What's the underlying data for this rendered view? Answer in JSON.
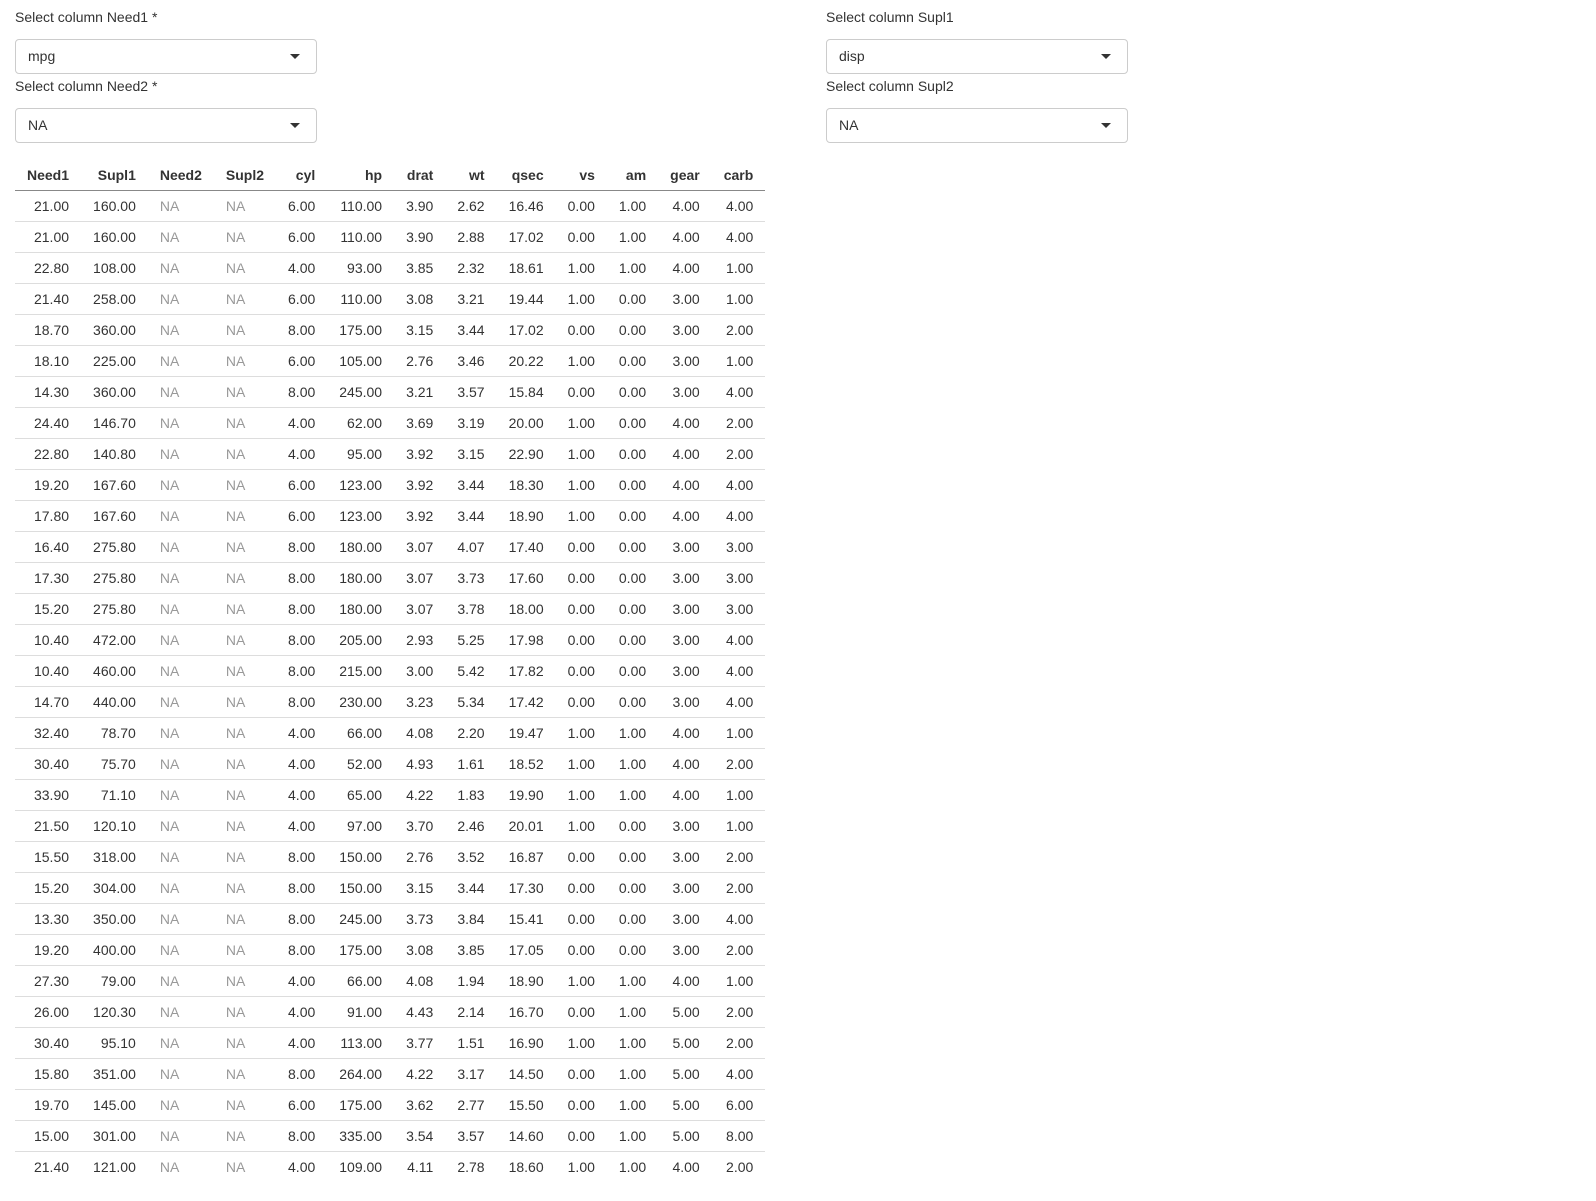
{
  "selectors": {
    "need1": {
      "label": "Select column Need1 *",
      "value": "mpg"
    },
    "need2": {
      "label": "Select column Need2 *",
      "value": "NA"
    },
    "supl1": {
      "label": "Select column Supl1",
      "value": "disp"
    },
    "supl2": {
      "label": "Select column Supl2",
      "value": "NA"
    }
  },
  "table": {
    "columns": [
      "Need1",
      "Supl1",
      "Need2",
      "Supl2",
      "cyl",
      "hp",
      "drat",
      "wt",
      "qsec",
      "vs",
      "am",
      "gear",
      "carb"
    ],
    "rows": [
      [
        "21.00",
        "160.00",
        "NA",
        "NA",
        "6.00",
        "110.00",
        "3.90",
        "2.62",
        "16.46",
        "0.00",
        "1.00",
        "4.00",
        "4.00"
      ],
      [
        "21.00",
        "160.00",
        "NA",
        "NA",
        "6.00",
        "110.00",
        "3.90",
        "2.88",
        "17.02",
        "0.00",
        "1.00",
        "4.00",
        "4.00"
      ],
      [
        "22.80",
        "108.00",
        "NA",
        "NA",
        "4.00",
        "93.00",
        "3.85",
        "2.32",
        "18.61",
        "1.00",
        "1.00",
        "4.00",
        "1.00"
      ],
      [
        "21.40",
        "258.00",
        "NA",
        "NA",
        "6.00",
        "110.00",
        "3.08",
        "3.21",
        "19.44",
        "1.00",
        "0.00",
        "3.00",
        "1.00"
      ],
      [
        "18.70",
        "360.00",
        "NA",
        "NA",
        "8.00",
        "175.00",
        "3.15",
        "3.44",
        "17.02",
        "0.00",
        "0.00",
        "3.00",
        "2.00"
      ],
      [
        "18.10",
        "225.00",
        "NA",
        "NA",
        "6.00",
        "105.00",
        "2.76",
        "3.46",
        "20.22",
        "1.00",
        "0.00",
        "3.00",
        "1.00"
      ],
      [
        "14.30",
        "360.00",
        "NA",
        "NA",
        "8.00",
        "245.00",
        "3.21",
        "3.57",
        "15.84",
        "0.00",
        "0.00",
        "3.00",
        "4.00"
      ],
      [
        "24.40",
        "146.70",
        "NA",
        "NA",
        "4.00",
        "62.00",
        "3.69",
        "3.19",
        "20.00",
        "1.00",
        "0.00",
        "4.00",
        "2.00"
      ],
      [
        "22.80",
        "140.80",
        "NA",
        "NA",
        "4.00",
        "95.00",
        "3.92",
        "3.15",
        "22.90",
        "1.00",
        "0.00",
        "4.00",
        "2.00"
      ],
      [
        "19.20",
        "167.60",
        "NA",
        "NA",
        "6.00",
        "123.00",
        "3.92",
        "3.44",
        "18.30",
        "1.00",
        "0.00",
        "4.00",
        "4.00"
      ],
      [
        "17.80",
        "167.60",
        "NA",
        "NA",
        "6.00",
        "123.00",
        "3.92",
        "3.44",
        "18.90",
        "1.00",
        "0.00",
        "4.00",
        "4.00"
      ],
      [
        "16.40",
        "275.80",
        "NA",
        "NA",
        "8.00",
        "180.00",
        "3.07",
        "4.07",
        "17.40",
        "0.00",
        "0.00",
        "3.00",
        "3.00"
      ],
      [
        "17.30",
        "275.80",
        "NA",
        "NA",
        "8.00",
        "180.00",
        "3.07",
        "3.73",
        "17.60",
        "0.00",
        "0.00",
        "3.00",
        "3.00"
      ],
      [
        "15.20",
        "275.80",
        "NA",
        "NA",
        "8.00",
        "180.00",
        "3.07",
        "3.78",
        "18.00",
        "0.00",
        "0.00",
        "3.00",
        "3.00"
      ],
      [
        "10.40",
        "472.00",
        "NA",
        "NA",
        "8.00",
        "205.00",
        "2.93",
        "5.25",
        "17.98",
        "0.00",
        "0.00",
        "3.00",
        "4.00"
      ],
      [
        "10.40",
        "460.00",
        "NA",
        "NA",
        "8.00",
        "215.00",
        "3.00",
        "5.42",
        "17.82",
        "0.00",
        "0.00",
        "3.00",
        "4.00"
      ],
      [
        "14.70",
        "440.00",
        "NA",
        "NA",
        "8.00",
        "230.00",
        "3.23",
        "5.34",
        "17.42",
        "0.00",
        "0.00",
        "3.00",
        "4.00"
      ],
      [
        "32.40",
        "78.70",
        "NA",
        "NA",
        "4.00",
        "66.00",
        "4.08",
        "2.20",
        "19.47",
        "1.00",
        "1.00",
        "4.00",
        "1.00"
      ],
      [
        "30.40",
        "75.70",
        "NA",
        "NA",
        "4.00",
        "52.00",
        "4.93",
        "1.61",
        "18.52",
        "1.00",
        "1.00",
        "4.00",
        "2.00"
      ],
      [
        "33.90",
        "71.10",
        "NA",
        "NA",
        "4.00",
        "65.00",
        "4.22",
        "1.83",
        "19.90",
        "1.00",
        "1.00",
        "4.00",
        "1.00"
      ],
      [
        "21.50",
        "120.10",
        "NA",
        "NA",
        "4.00",
        "97.00",
        "3.70",
        "2.46",
        "20.01",
        "1.00",
        "0.00",
        "3.00",
        "1.00"
      ],
      [
        "15.50",
        "318.00",
        "NA",
        "NA",
        "8.00",
        "150.00",
        "2.76",
        "3.52",
        "16.87",
        "0.00",
        "0.00",
        "3.00",
        "2.00"
      ],
      [
        "15.20",
        "304.00",
        "NA",
        "NA",
        "8.00",
        "150.00",
        "3.15",
        "3.44",
        "17.30",
        "0.00",
        "0.00",
        "3.00",
        "2.00"
      ],
      [
        "13.30",
        "350.00",
        "NA",
        "NA",
        "8.00",
        "245.00",
        "3.73",
        "3.84",
        "15.41",
        "0.00",
        "0.00",
        "3.00",
        "4.00"
      ],
      [
        "19.20",
        "400.00",
        "NA",
        "NA",
        "8.00",
        "175.00",
        "3.08",
        "3.85",
        "17.05",
        "0.00",
        "0.00",
        "3.00",
        "2.00"
      ],
      [
        "27.30",
        "79.00",
        "NA",
        "NA",
        "4.00",
        "66.00",
        "4.08",
        "1.94",
        "18.90",
        "1.00",
        "1.00",
        "4.00",
        "1.00"
      ],
      [
        "26.00",
        "120.30",
        "NA",
        "NA",
        "4.00",
        "91.00",
        "4.43",
        "2.14",
        "16.70",
        "0.00",
        "1.00",
        "5.00",
        "2.00"
      ],
      [
        "30.40",
        "95.10",
        "NA",
        "NA",
        "4.00",
        "113.00",
        "3.77",
        "1.51",
        "16.90",
        "1.00",
        "1.00",
        "5.00",
        "2.00"
      ],
      [
        "15.80",
        "351.00",
        "NA",
        "NA",
        "8.00",
        "264.00",
        "4.22",
        "3.17",
        "14.50",
        "0.00",
        "1.00",
        "5.00",
        "4.00"
      ],
      [
        "19.70",
        "145.00",
        "NA",
        "NA",
        "6.00",
        "175.00",
        "3.62",
        "2.77",
        "15.50",
        "0.00",
        "1.00",
        "5.00",
        "6.00"
      ],
      [
        "15.00",
        "301.00",
        "NA",
        "NA",
        "8.00",
        "335.00",
        "3.54",
        "3.57",
        "14.60",
        "0.00",
        "1.00",
        "5.00",
        "8.00"
      ],
      [
        "21.40",
        "121.00",
        "NA",
        "NA",
        "4.00",
        "109.00",
        "4.11",
        "2.78",
        "18.60",
        "1.00",
        "1.00",
        "4.00",
        "2.00"
      ]
    ]
  }
}
